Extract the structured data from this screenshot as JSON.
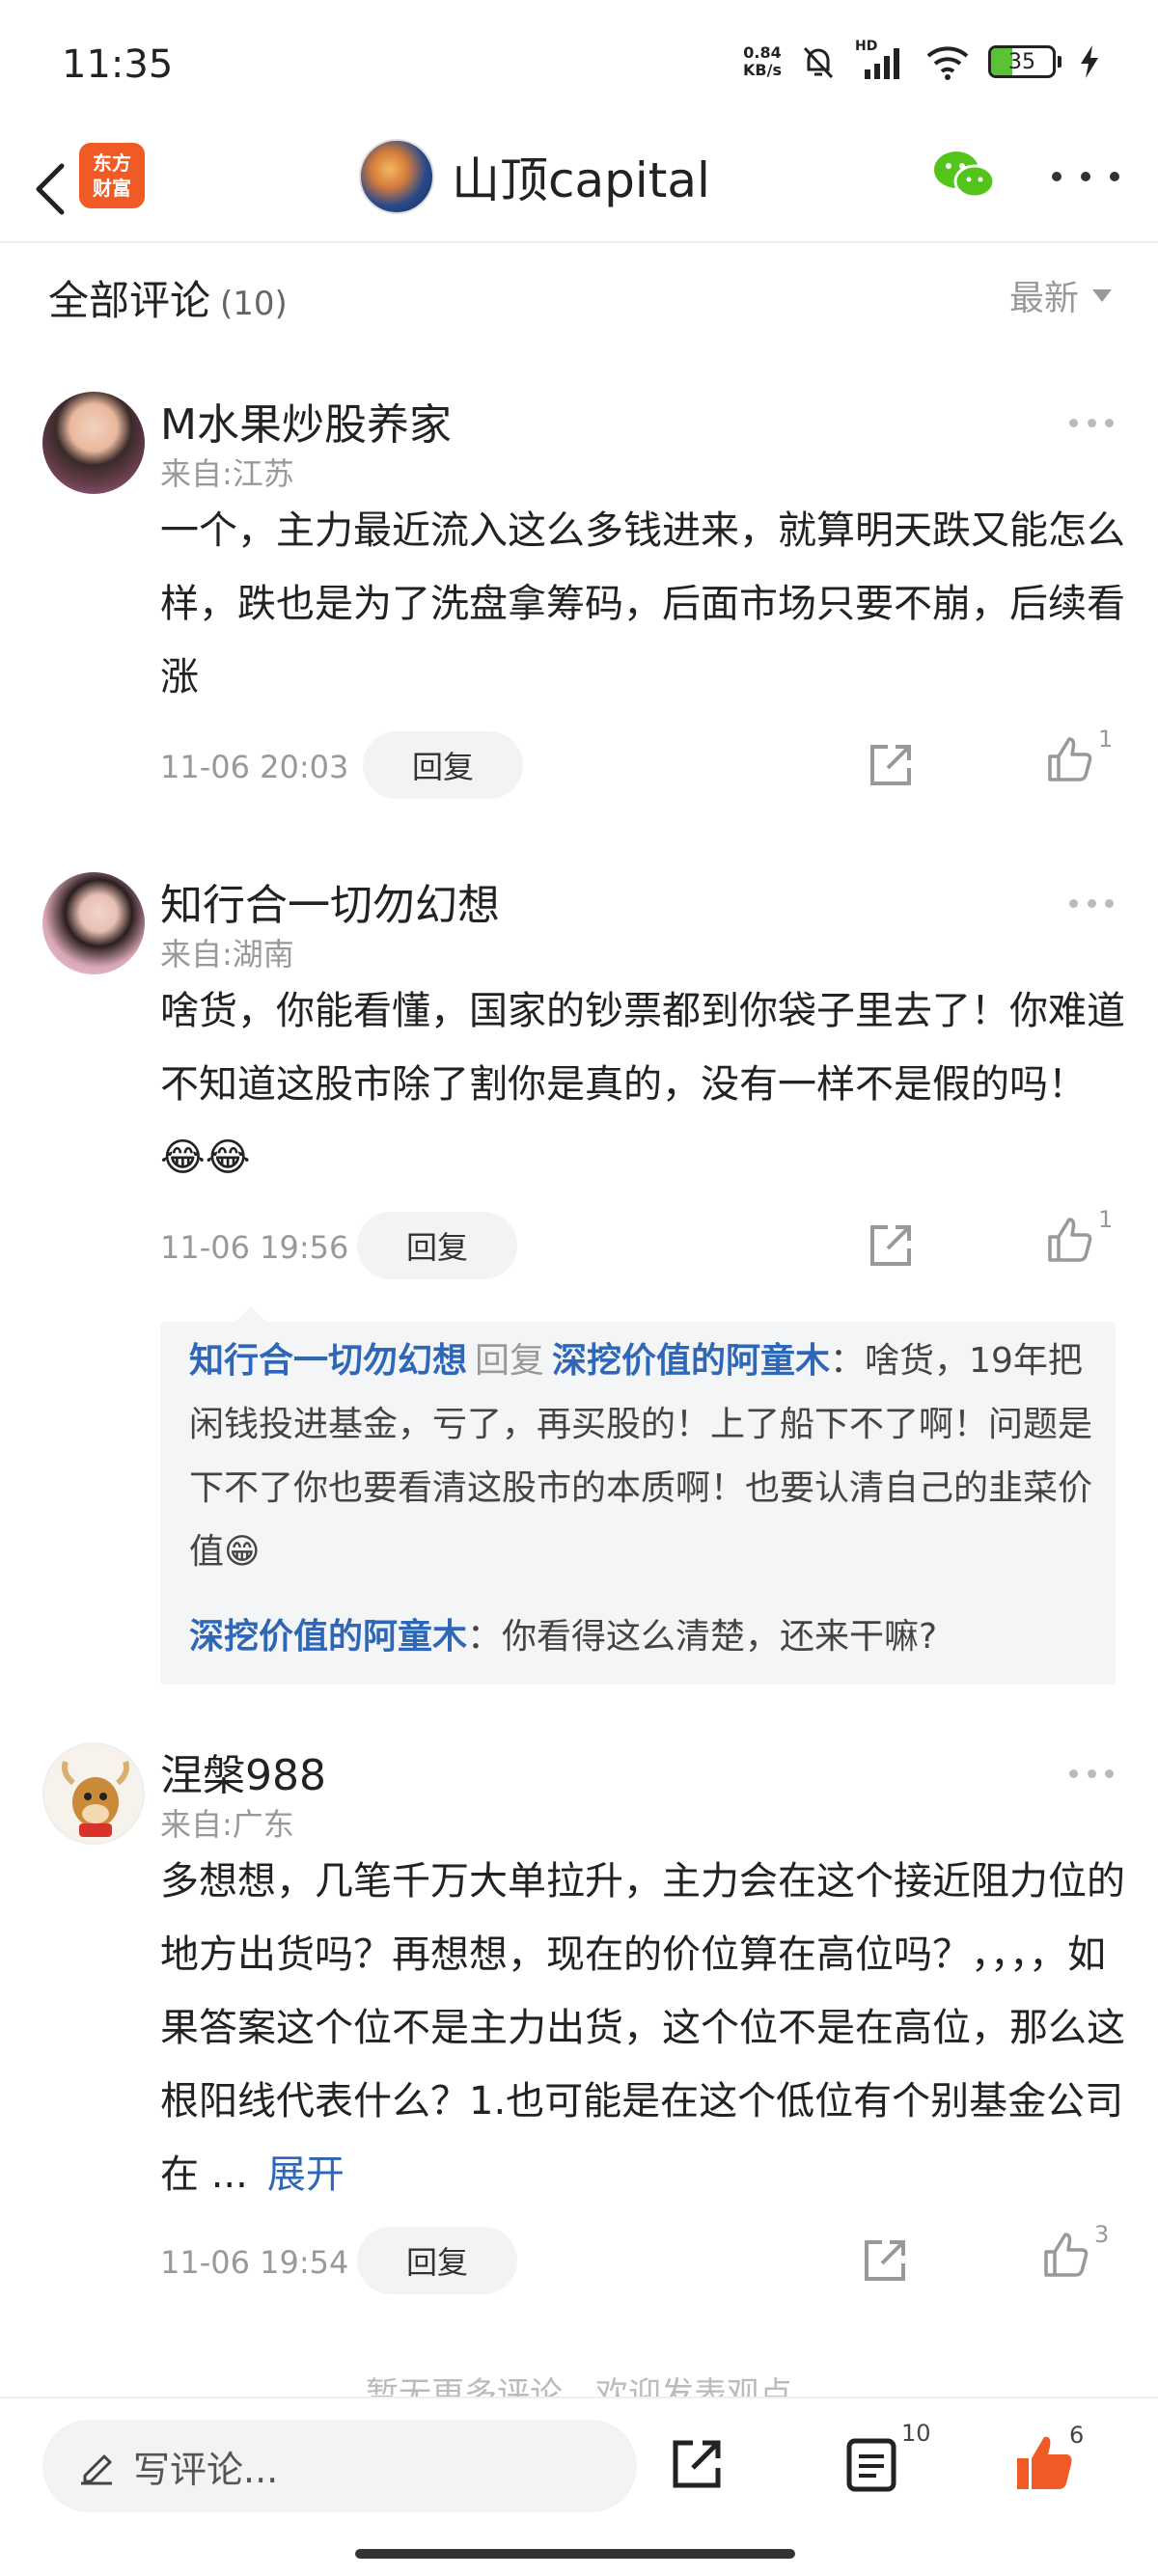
{
  "status_bar": {
    "time": "11:35",
    "net_speed_value": "0.84",
    "net_speed_unit": "KB/s",
    "signal_label": "HD",
    "battery": "35",
    "battery_level": 0.35
  },
  "header": {
    "back_icon": "chevron-left-icon",
    "app_logo_text": "东方财富",
    "channel_name": "山顶capital",
    "wechat_icon": "wechat-icon",
    "more_icon": "more-icon"
  },
  "comments_section": {
    "title": "全部评论",
    "count": "(10)",
    "sort_label": "最新"
  },
  "comments": [
    {
      "username": "M水果炒股养家",
      "location": "来自:江苏",
      "text": "一个，主力最近流入这么多钱进来，就算明天跌又能怎么样，跌也是为了洗盘拿筹码，后面市场只要不崩，后续看涨",
      "date": "11-06 20:03",
      "reply_label": "回复",
      "likes": "1"
    },
    {
      "username": "知行合一切勿幻想",
      "location": "来自:湖南",
      "text": "啥货，你能看懂，国家的钞票都到你袋子里去了！你难道不知道这股市除了割你是真的，没有一样不是假的吗！ 😂😂",
      "date": "11-06 19:56",
      "reply_label": "回复",
      "likes": "1",
      "replies": [
        {
          "from": "知行合一切勿幻想",
          "reply_word": "回复",
          "to": "深挖价值的阿童木",
          "text": "：啥货，19年把闲钱投进基金，亏了，再买股的！上了船下不了啊！问题是下不了你也要看清这股市的本质啊！也要认清自己的韭菜价值😁"
        },
        {
          "from": "深挖价值的阿童木",
          "text": "：你看得这么清楚，还来干嘛?"
        }
      ]
    },
    {
      "username": "涅槃988",
      "location": "来自:广东",
      "text": "多想想，几笔千万大单拉升，主力会在这个接近阻力位的地方出货吗？再想想，现在的价位算在高位吗？，，，，如果答案这个位不是主力出货，这个位不是在高位，那么这根阳线代表什么？1.也可能是在这个低位有个别基金公司在 ...",
      "expand_label": "展开",
      "date": "11-06 19:54",
      "reply_label": "回复",
      "likes": "3"
    }
  ],
  "footer_note": "暂无更多评论，欢迎发表观点",
  "bottom_bar": {
    "write_placeholder": "写评论...",
    "comment_count": "10",
    "like_count": "6"
  },
  "colors": {
    "link_blue": "#2e66b8",
    "like_orange": "#f05a24",
    "wechat_green": "#52c41a"
  }
}
